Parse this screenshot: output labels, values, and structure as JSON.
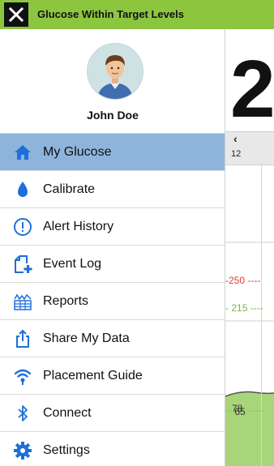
{
  "banner": {
    "title": "Glucose Within Target Levels",
    "color": "#8cc63f"
  },
  "user": {
    "name": "John Doe"
  },
  "menu": {
    "items": [
      {
        "label": "My Glucose",
        "icon": "home-icon",
        "active": true
      },
      {
        "label": "Calibrate",
        "icon": "drop-icon"
      },
      {
        "label": "Alert History",
        "icon": "alert-icon"
      },
      {
        "label": "Event Log",
        "icon": "event-log-icon"
      },
      {
        "label": "Reports",
        "icon": "reports-icon"
      },
      {
        "label": "Share My Data",
        "icon": "share-icon"
      },
      {
        "label": "Placement Guide",
        "icon": "placement-guide-icon"
      },
      {
        "label": "Connect",
        "icon": "bluetooth-icon"
      },
      {
        "label": "Settings",
        "icon": "gear-icon"
      }
    ]
  },
  "background_app": {
    "glucose_value": "2",
    "time_label": "12",
    "high_line": "250",
    "target_line": "215",
    "low_line_a": "78",
    "low_line_b": "65"
  },
  "colors": {
    "active_item": "#8fb4dc",
    "accent_blue": "#1e6fd9",
    "high_line": "#e53935",
    "target_line": "#8cc63f",
    "chart_fill": "#a9d57a"
  }
}
